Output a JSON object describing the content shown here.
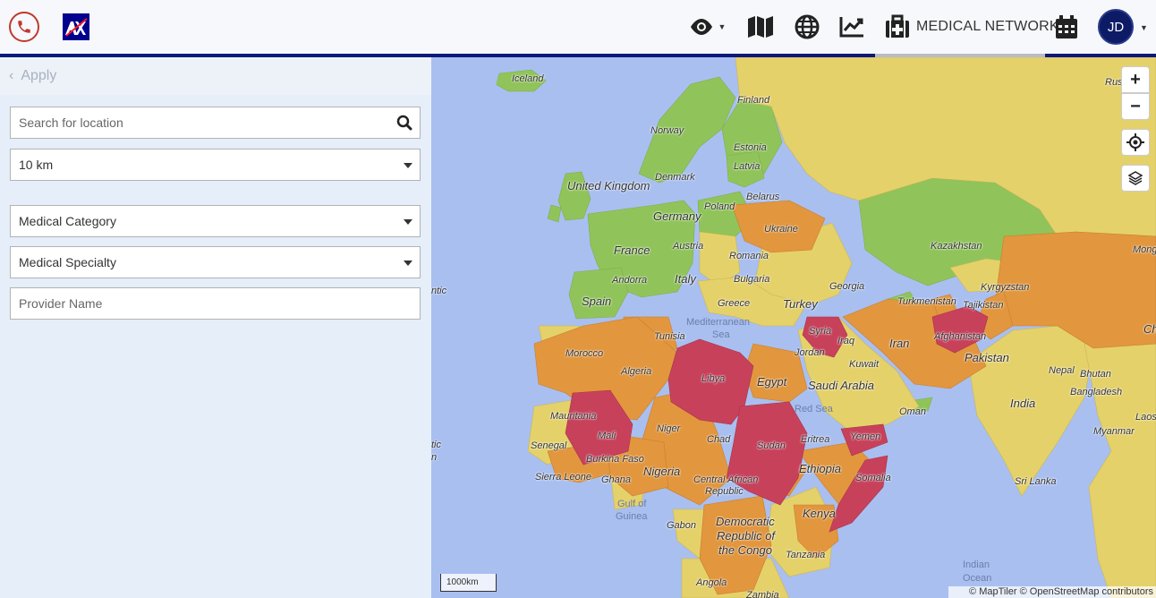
{
  "header": {
    "network_label": "MEDICAL NETWORK",
    "user_initials": "JD",
    "icons": [
      "phone-icon",
      "axa-logo",
      "eye-icon",
      "map-icon",
      "globe-icon",
      "chart-icon",
      "medical-kit-icon",
      "calendar-icon"
    ]
  },
  "sidebar": {
    "apply_label": "Apply",
    "search": {
      "placeholder": "Search for location"
    },
    "radius": {
      "value": "10 km"
    },
    "category": {
      "value": "Medical Category"
    },
    "specialty": {
      "value": "Medical Specialty"
    },
    "provider": {
      "placeholder": "Provider Name"
    }
  },
  "map": {
    "labels": {
      "iceland": "Iceland",
      "finland": "Finland",
      "norway": "Norway",
      "estonia": "Estonia",
      "latvia": "Latvia",
      "denmark": "Denmark",
      "uk": "United Kingdom",
      "belarus": "Belarus",
      "poland": "Poland",
      "germany": "Germany",
      "ukraine": "Ukraine",
      "kazakhstan": "Kazakhstan",
      "mongolia": "Mongo",
      "russia": "Rus",
      "france": "France",
      "austria": "Austria",
      "romania": "Romania",
      "andorra": "Andorra",
      "italy": "Italy",
      "bulgaria": "Bulgaria",
      "georgia": "Georgia",
      "kyrgyzstan": "Kyrgyzstan",
      "turkmenistan": "Turkmenistan",
      "tajikistan": "Tajikistan",
      "spain": "Spain",
      "greece": "Greece",
      "turkey": "Turkey",
      "china": "Ch",
      "syria": "Syria",
      "iraq": "Iraq",
      "iran": "Iran",
      "afghanistan": "Afghanistan",
      "tunisia": "Tunisia",
      "jordan": "Jordan",
      "kuwait": "Kuwait",
      "pakistan": "Pakistan",
      "nepal": "Nepal",
      "bhutan": "Bhutan",
      "morocco": "Morocco",
      "algeria": "Algeria",
      "libya": "Libya",
      "egypt": "Egypt",
      "saudi": "Saudi Arabia",
      "bangladesh": "Bangladesh",
      "india": "India",
      "laos": "Laos",
      "mauritania": "Mauritania",
      "oman": "Oman",
      "niger": "Niger",
      "mali": "Mali",
      "chad": "Chad",
      "sudan": "Sudan",
      "eritrea": "Eritrea",
      "yemen": "Yemen",
      "myanmar": "Myanmar",
      "senegal": "Senegal",
      "burkina": "Burkina Faso",
      "nigeria": "Nigeria",
      "ethiopia": "Ethiopia",
      "sierra": "Sierra Leone",
      "ghana": "Ghana",
      "car1": "Central African",
      "car2": "Republic",
      "somalia": "Somalia",
      "srilanka": "Sri Lanka",
      "gabon": "Gabon",
      "drc1": "Democratic",
      "drc2": "Republic of",
      "drc3": "the Congo",
      "kenya": "Kenya",
      "tanzania": "Tanzania",
      "angola": "Angola",
      "zambia": "Zambia",
      "atlantic1": "ntic",
      "atlantic2": "tic",
      "atlantic3": "n"
    },
    "seas": {
      "med1": "Mediterranean",
      "med2": "Sea",
      "red": "Red Sea",
      "gulf1": "Gulf of",
      "gulf2": "Guinea",
      "indian1": "Indian",
      "indian2": "Ocean"
    },
    "scale": "1000km",
    "attribution": "© MapTiler © OpenStreetMap contributors",
    "controls": [
      "zoom-in",
      "zoom-out",
      "locate",
      "layers"
    ],
    "zoom_in_label": "+",
    "zoom_out_label": "−",
    "colors": {
      "water": "#a9bff0",
      "low": "#90c45a",
      "medium": "#e5d16a",
      "high": "#e2963e",
      "very_high": "#c8415b"
    }
  }
}
